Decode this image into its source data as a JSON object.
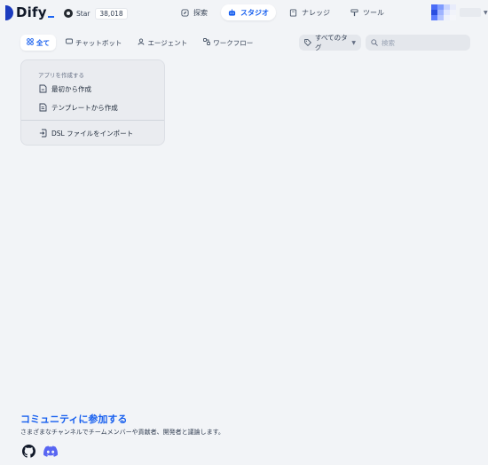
{
  "header": {
    "logo_text": "Dify",
    "star_label": "Star",
    "star_count": "38,018",
    "nav": [
      {
        "label": "探索",
        "icon": "compass-icon"
      },
      {
        "label": "スタジオ",
        "icon": "robot-icon",
        "active": true
      },
      {
        "label": "ナレッジ",
        "icon": "book-icon"
      },
      {
        "label": "ツール",
        "icon": "hammer-icon"
      }
    ],
    "avatar_colors": [
      "#4a6cf7",
      "#7f9cff",
      "#c8d4ff",
      "#e8ecfb",
      "#2a4ee0",
      "#9fb3ff",
      "#dfe6ff",
      "#f1f3fa",
      "#5b7cff",
      "#b5c5ff",
      "#eef1fb",
      "#f5f6fa"
    ]
  },
  "toolbar": {
    "tabs": [
      {
        "label": "全て",
        "icon": "grid-icon",
        "active": true
      },
      {
        "label": "チャットボット",
        "icon": "chat-icon"
      },
      {
        "label": "エージェント",
        "icon": "agent-icon"
      },
      {
        "label": "ワークフロー",
        "icon": "workflow-icon"
      }
    ],
    "tag_filter_label": "すべてのタグ",
    "search_placeholder": "検索"
  },
  "create_card": {
    "heading": "アプリを作成する",
    "items": [
      {
        "label": "最初から作成",
        "icon": "file-plus-icon"
      },
      {
        "label": "テンプレートから作成",
        "icon": "file-template-icon"
      },
      {
        "label": "DSL ファイルをインポート",
        "icon": "import-icon"
      }
    ]
  },
  "footer": {
    "title": "コミュニティに参加する",
    "description": "さまざまなチャンネルでチームメンバーや貢献者、開発者と議論します。"
  },
  "colors": {
    "accent": "#155eef",
    "background": "#f2f4f7"
  }
}
